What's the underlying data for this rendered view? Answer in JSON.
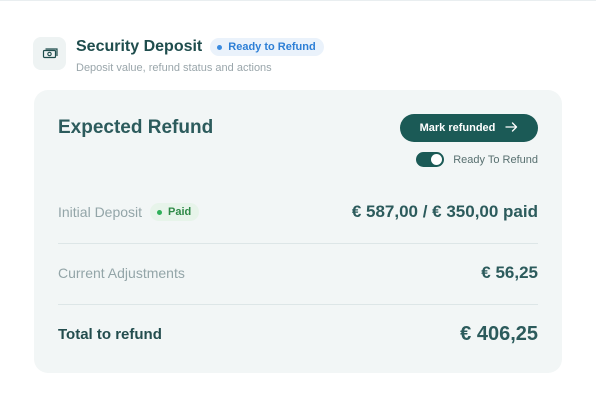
{
  "header": {
    "title": "Security Deposit",
    "status": "Ready to Refund",
    "subtitle": "Deposit value, refund status and actions",
    "icon": "money-icon"
  },
  "card": {
    "title": "Expected Refund",
    "mark_button": "Mark refunded",
    "toggle_label": "Ready To Refund",
    "toggle_on": true,
    "rows": [
      {
        "label": "Initial Deposit",
        "badge": "Paid",
        "value": "€ 587,00 / € 350,00 paid"
      },
      {
        "label": "Current Adjustments",
        "value": "€ 56,25"
      }
    ],
    "total": {
      "label": "Total to refund",
      "value": "€ 406,25"
    }
  },
  "colors": {
    "primary": "#1b5a56",
    "status_blue": "#2d7fd6",
    "paid_green": "#2f8a48",
    "card_bg": "#f2f6f6"
  }
}
